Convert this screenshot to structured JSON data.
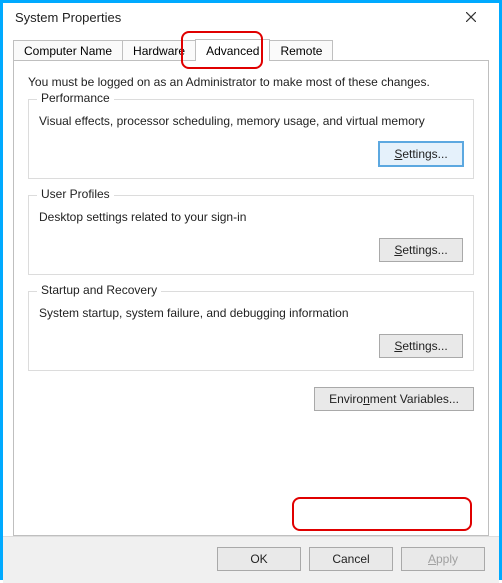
{
  "titlebar": {
    "title": "System Properties"
  },
  "tabs": {
    "computer_name": "Computer Name",
    "hardware": "Hardware",
    "advanced": "Advanced",
    "remote": "Remote"
  },
  "intro": "You must be logged on as an Administrator to make most of these changes.",
  "performance": {
    "legend": "Performance",
    "body": "Visual effects, processor scheduling, memory usage, and virtual memory",
    "settings_prefix": "S",
    "settings_rest": "ettings..."
  },
  "user_profiles": {
    "legend": "User Profiles",
    "body": "Desktop settings related to your sign-in",
    "settings_prefix": "S",
    "settings_rest": "ettings..."
  },
  "startup": {
    "legend": "Startup and Recovery",
    "body": "System startup, system failure, and debugging information",
    "settings_prefix": "S",
    "settings_rest": "ettings..."
  },
  "env_btn_prefix": "Enviro",
  "env_btn_underline": "n",
  "env_btn_rest": "ment Variables...",
  "buttons": {
    "ok": "OK",
    "cancel": "Cancel",
    "apply_prefix": "A",
    "apply_rest": "pply"
  }
}
